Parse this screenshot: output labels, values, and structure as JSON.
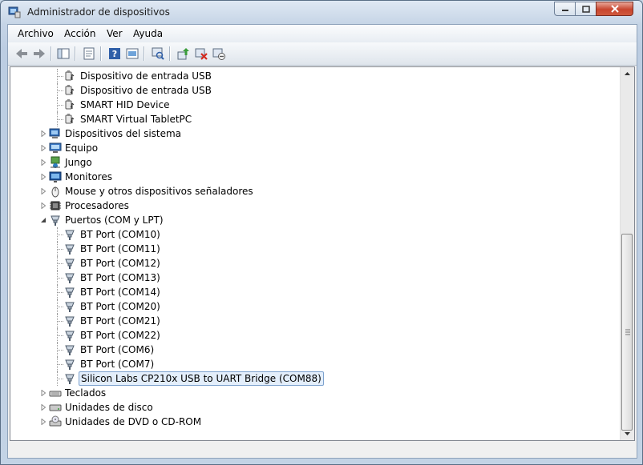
{
  "window": {
    "title": "Administrador de dispositivos"
  },
  "menu": [
    "Archivo",
    "Acción",
    "Ver",
    "Ayuda"
  ],
  "toolbar": [
    "back-icon",
    "forward-icon",
    "show-hide-tree-icon",
    "properties-icon",
    "help-icon",
    "view-icon",
    "scan-hardware-icon",
    "update-driver-icon",
    "uninstall-icon",
    "disable-icon"
  ],
  "tree": [
    {
      "label": "Dispositivo de entrada USB",
      "level": 2,
      "icon": "usb-hid-icon"
    },
    {
      "label": "Dispositivo de entrada USB",
      "level": 2,
      "icon": "usb-hid-icon"
    },
    {
      "label": "SMART HID Device",
      "level": 2,
      "icon": "usb-hid-icon"
    },
    {
      "label": "SMART Virtual TabletPC",
      "level": 2,
      "icon": "usb-hid-icon"
    },
    {
      "label": "Dispositivos del sistema",
      "level": 1,
      "icon": "system-devices-icon",
      "expander": "collapsed"
    },
    {
      "label": "Equipo",
      "level": 1,
      "icon": "computer-icon",
      "expander": "collapsed"
    },
    {
      "label": "Jungo",
      "level": 1,
      "icon": "jungo-icon",
      "expander": "collapsed"
    },
    {
      "label": "Monitores",
      "level": 1,
      "icon": "monitor-icon",
      "expander": "collapsed"
    },
    {
      "label": "Mouse y otros dispositivos señaladores",
      "level": 1,
      "icon": "mouse-icon",
      "expander": "collapsed"
    },
    {
      "label": "Procesadores",
      "level": 1,
      "icon": "processor-icon",
      "expander": "collapsed"
    },
    {
      "label": "Puertos (COM y LPT)",
      "level": 1,
      "icon": "port-icon",
      "expander": "expanded"
    },
    {
      "label": "BT Port (COM10)",
      "level": 2,
      "icon": "port-icon"
    },
    {
      "label": "BT Port (COM11)",
      "level": 2,
      "icon": "port-icon"
    },
    {
      "label": "BT Port (COM12)",
      "level": 2,
      "icon": "port-icon"
    },
    {
      "label": "BT Port (COM13)",
      "level": 2,
      "icon": "port-icon"
    },
    {
      "label": "BT Port (COM14)",
      "level": 2,
      "icon": "port-icon"
    },
    {
      "label": "BT Port (COM20)",
      "level": 2,
      "icon": "port-icon"
    },
    {
      "label": "BT Port (COM21)",
      "level": 2,
      "icon": "port-icon"
    },
    {
      "label": "BT Port (COM22)",
      "level": 2,
      "icon": "port-icon"
    },
    {
      "label": "BT Port (COM6)",
      "level": 2,
      "icon": "port-icon"
    },
    {
      "label": "BT Port (COM7)",
      "level": 2,
      "icon": "port-icon"
    },
    {
      "label": "Silicon Labs CP210x USB to UART Bridge (COM88)",
      "level": 2,
      "icon": "port-icon",
      "selected": true
    },
    {
      "label": "Teclados",
      "level": 1,
      "icon": "keyboard-icon",
      "expander": "collapsed"
    },
    {
      "label": "Unidades de disco",
      "level": 1,
      "icon": "disk-drive-icon",
      "expander": "collapsed"
    },
    {
      "label": "Unidades de DVD o CD-ROM",
      "level": 1,
      "icon": "dvd-drive-icon",
      "expander": "collapsed"
    }
  ]
}
